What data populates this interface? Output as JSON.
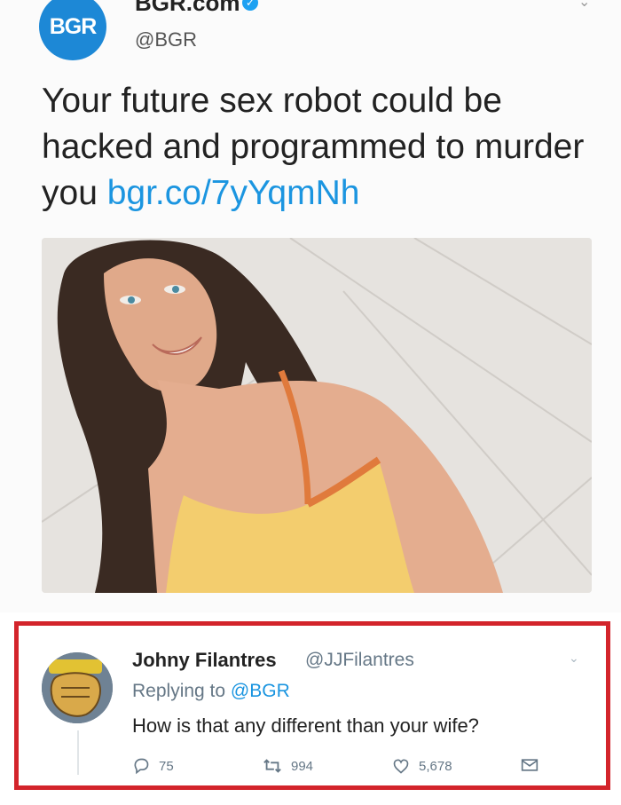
{
  "tweet": {
    "avatar_text": "BGR",
    "display_name": "BGR.com",
    "verified_glyph": "✓",
    "handle": "@BGR",
    "text": "Your future sex robot could be hacked and programmed to murder you ",
    "link": "bgr.co/7yYqmNh",
    "caret_glyph": "⌄"
  },
  "reply": {
    "name": "Johny Filantres",
    "handle": "@JJFilantres",
    "replying_prefix": "Replying to ",
    "replying_handle": "@BGR",
    "text": "How is that any different than your wife?",
    "caret_glyph": "⌄",
    "stats": {
      "replies": "75",
      "retweets": "994",
      "likes": "5,678"
    }
  },
  "colors": {
    "accent": "#1b95e0",
    "highlight_border": "#d3242b",
    "bgr_blue": "#1d88d6"
  },
  "icons": [
    "reply-icon",
    "retweet-icon",
    "like-icon",
    "dm-icon",
    "verified-icon",
    "chevron-down-icon"
  ]
}
